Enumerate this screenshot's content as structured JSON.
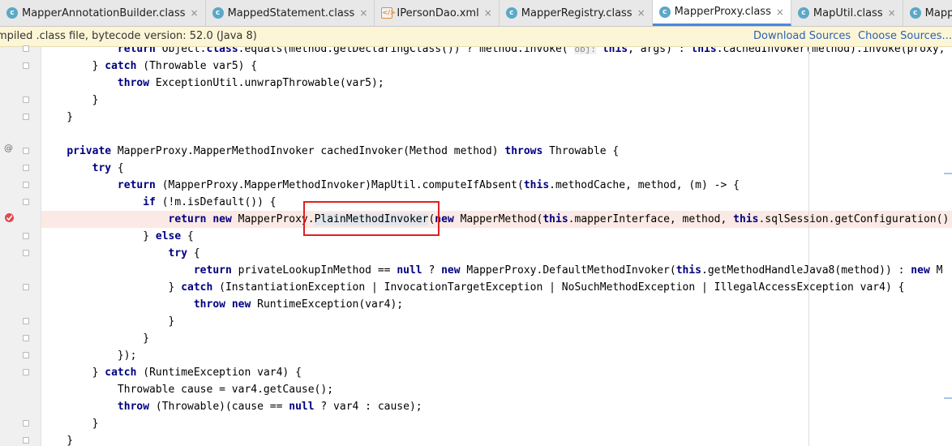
{
  "tabs": [
    {
      "label": "MapperAnnotationBuilder.class",
      "icon": "class-icon",
      "close": "×",
      "active": false
    },
    {
      "label": "MappedStatement.class",
      "icon": "class-icon",
      "close": "×",
      "active": false
    },
    {
      "label": "IPersonDao.xml",
      "icon": "xml-icon",
      "close": "×",
      "active": false
    },
    {
      "label": "MapperRegistry.class",
      "icon": "class-icon",
      "close": "×",
      "active": false
    },
    {
      "label": "MapperProxy.class",
      "icon": "class-icon",
      "close": "×",
      "active": true
    },
    {
      "label": "MapUtil.class",
      "icon": "class-icon",
      "close": "×",
      "active": false
    },
    {
      "label": "MapperMethod.clas",
      "icon": "class-icon",
      "close": "",
      "active": false
    }
  ],
  "tab_overflow": "⌄≡",
  "notice": {
    "message": "mpiled .class file, bytecode version: 52.0 (Java 8)",
    "download_sources": "Download Sources",
    "choose_sources": "Choose Sources..."
  },
  "gutter": {
    "override_marker": "@"
  },
  "code": [
    {
      "tokens": [
        [
          "            "
        ],
        [
          "return",
          "kw"
        ],
        [
          " Object."
        ],
        [
          "class",
          "kw"
        ],
        [
          ".equals(method.getDeclaringClass()) ? method.invoke( "
        ],
        [
          "obj:",
          "hint"
        ],
        [
          " "
        ],
        [
          "this",
          "kw"
        ],
        [
          ", args) : "
        ],
        [
          "this",
          "kw"
        ],
        [
          ".cachedInvoker(method).invoke(proxy, "
        ]
      ]
    },
    {
      "tokens": [
        [
          "        } "
        ],
        [
          "catch",
          "kw"
        ],
        [
          " (Throwable var5) {"
        ]
      ]
    },
    {
      "tokens": [
        [
          "            "
        ],
        [
          "throw",
          "kw"
        ],
        [
          " ExceptionUtil.unwrapThrowable(var5);"
        ]
      ]
    },
    {
      "tokens": [
        [
          "        }"
        ]
      ]
    },
    {
      "tokens": [
        [
          "    }"
        ]
      ]
    },
    {
      "tokens": [
        [
          ""
        ]
      ]
    },
    {
      "tokens": [
        [
          "    "
        ],
        [
          "private",
          "kw"
        ],
        [
          " MapperProxy.MapperMethodInvoker cachedInvoker(Method method) "
        ],
        [
          "throws",
          "kw"
        ],
        [
          " Throwable {"
        ]
      ]
    },
    {
      "tokens": [
        [
          "        "
        ],
        [
          "try",
          "kw"
        ],
        [
          " {"
        ]
      ]
    },
    {
      "tokens": [
        [
          "            "
        ],
        [
          "return",
          "kw"
        ],
        [
          " (MapperProxy.MapperMethodInvoker)MapUtil.computeIfAbsent("
        ],
        [
          "this",
          "kw"
        ],
        [
          ".methodCache, method, (m) -> {"
        ]
      ]
    },
    {
      "tokens": [
        [
          "                "
        ],
        [
          "if",
          "kw"
        ],
        [
          " (!m.isDefault()) {"
        ]
      ]
    },
    {
      "tokens": [
        [
          "                    "
        ],
        [
          "return",
          "kw"
        ],
        [
          " "
        ],
        [
          "new",
          "kw"
        ],
        [
          " MapperProxy."
        ],
        [
          "PlainMethodInvoker",
          "hl"
        ],
        [
          "("
        ],
        [
          "new",
          "kw"
        ],
        [
          " MapperMethod("
        ],
        [
          "this",
          "kw"
        ],
        [
          ".mapperInterface, method, "
        ],
        [
          "this",
          "kw"
        ],
        [
          ".sqlSession.getConfiguration()"
        ]
      ]
    },
    {
      "tokens": [
        [
          "                } "
        ],
        [
          "else",
          "kw"
        ],
        [
          " {"
        ]
      ]
    },
    {
      "tokens": [
        [
          "                    "
        ],
        [
          "try",
          "kw"
        ],
        [
          " {"
        ]
      ]
    },
    {
      "tokens": [
        [
          "                        "
        ],
        [
          "return",
          "kw"
        ],
        [
          " privateLookupInMethod == "
        ],
        [
          "null",
          "kw"
        ],
        [
          " ? "
        ],
        [
          "new",
          "kw"
        ],
        [
          " MapperProxy.DefaultMethodInvoker("
        ],
        [
          "this",
          "kw"
        ],
        [
          ".getMethodHandleJava8(method)) : "
        ],
        [
          "new",
          "kw"
        ],
        [
          " M"
        ]
      ]
    },
    {
      "tokens": [
        [
          "                    } "
        ],
        [
          "catch",
          "kw"
        ],
        [
          " (InstantiationException | InvocationTargetException | NoSuchMethodException | IllegalAccessException var4) {"
        ]
      ]
    },
    {
      "tokens": [
        [
          "                        "
        ],
        [
          "throw",
          "kw"
        ],
        [
          " "
        ],
        [
          "new",
          "kw"
        ],
        [
          " RuntimeException(var4);"
        ]
      ]
    },
    {
      "tokens": [
        [
          "                    }"
        ]
      ]
    },
    {
      "tokens": [
        [
          "                }"
        ]
      ]
    },
    {
      "tokens": [
        [
          "            });"
        ]
      ]
    },
    {
      "tokens": [
        [
          "        } "
        ],
        [
          "catch",
          "kw"
        ],
        [
          " (RuntimeException var4) {"
        ]
      ]
    },
    {
      "tokens": [
        [
          "            Throwable cause = var4.getCause();"
        ]
      ]
    },
    {
      "tokens": [
        [
          "            "
        ],
        [
          "throw",
          "kw"
        ],
        [
          " (Throwable)(cause == "
        ],
        [
          "null",
          "kw"
        ],
        [
          " ? var4 : cause);"
        ]
      ]
    },
    {
      "tokens": [
        [
          "        }"
        ]
      ]
    },
    {
      "tokens": [
        [
          "    }"
        ]
      ]
    }
  ]
}
